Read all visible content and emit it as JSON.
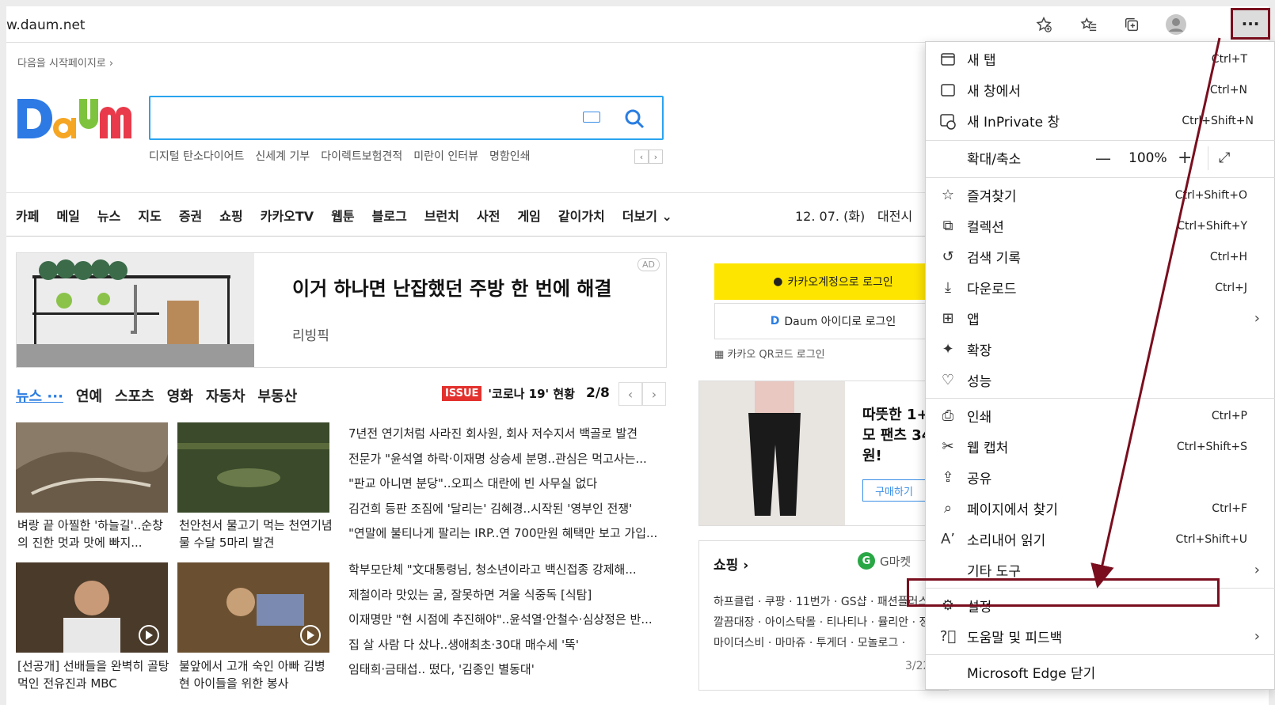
{
  "browser": {
    "url": "w.daum.net"
  },
  "daum": {
    "start_page_link": "다음을 시작페이지로 ›",
    "search": {
      "placeholder": "",
      "suggestions": [
        "디지털 탄소다이어트",
        "신세계 기부",
        "다이렉트보험견적",
        "미란이 인터뷰",
        "명함인쇄"
      ]
    },
    "nav": [
      "카페",
      "메일",
      "뉴스",
      "지도",
      "증권",
      "쇼핑",
      "카카오TV",
      "웹툰",
      "블로그",
      "브런치",
      "사전",
      "게임",
      "같이가치",
      "더보기"
    ],
    "date": "12. 07. (화)",
    "city": "대전시",
    "ad": {
      "title": "이거 하나면 난잡했던 주방 한 번에 해결",
      "source": "리빙픽",
      "badge": "AD"
    },
    "news_tabs": [
      "뉴스",
      "연예",
      "스포츠",
      "영화",
      "자동차",
      "부동산"
    ],
    "issue": {
      "badge": "ISSUE",
      "text": "'코로나 19' 현황",
      "count": "2/8"
    },
    "photo_news": [
      {
        "caption": "벼랑 끝 아찔한 '하늘길'..순창의 진한 멋과 맛에 빠지..."
      },
      {
        "caption": "천안천서 물고기 먹는 천연기념물 수달 5마리 발견"
      },
      {
        "caption": "[선공개] 선배들을 완벽히 골탕 먹인 전유진과 MBC"
      },
      {
        "caption": "불앞에서 고개 숙인 아빠 김병현 아이들을 위한 봉사"
      }
    ],
    "headlines": [
      "7년전 연기처럼 사라진 회사원, 회사 저수지서 백골로 발견",
      "전문가 \"윤석열 하락·이재명 상승세 분명..관심은 먹고사는...",
      "\"판교 아니면 분당\"..오피스 대란에 빈 사무실 없다",
      "김건희 등판 조짐에 '달리는' 김혜경..시작된 '영부인 전쟁'",
      "\"연말에 불티나게 팔리는 IRP..연 700만원 혜택만 보고 가입...",
      "학부모단체 \"文대통령님, 청소년이라고 백신접종 강제해...",
      "제철이라 맛있는 굴, 잘못하면 겨울 식중독 [식탐]",
      "이재명만 \"현 시점에 추진해야\"..윤석열·안철수·심상정은 반...",
      "집 살 사람 다 샀나..생애최초·30대 매수세 '뚝'",
      "임태희·금태섭.. 떴다, '김종인 별동대'"
    ],
    "login": {
      "kakao": "카카오계정으로 로그인",
      "daum": "Daum 아이디로 로그인",
      "qr": "카카오 QR코드 로그인"
    },
    "ad2": {
      "title_lines": [
        "따뜻한 1+1",
        "모 팬츠 34",
        "원!"
      ],
      "button": "구매하기"
    },
    "shopping": {
      "title": "쇼핑 ›",
      "gmarket": "G마켓",
      "lines": [
        "하프클럽 · 쿠팡 · 11번가 · GS샵 · 패션플러스 ·",
        "깔끔대장 · 아이스탁몰 · 티나티나 · 뮬리안 · 정",
        "마이더스비 · 마마쥬 · 투게더 · 모놀로그 ·"
      ],
      "page": "3/22"
    }
  },
  "edge_menu": {
    "items": [
      {
        "label": "새 탭",
        "shortcut": "Ctrl+T",
        "icon": "new-tab-icon"
      },
      {
        "label": "새 창에서",
        "shortcut": "Ctrl+N",
        "icon": "new-window-icon"
      },
      {
        "label": "새 InPrivate 창",
        "shortcut": "Ctrl+Shift+N",
        "icon": "inprivate-icon"
      },
      {
        "label": "확대/축소",
        "zoom": "100%"
      },
      {
        "label": "즐겨찾기",
        "shortcut": "Ctrl+Shift+O",
        "icon": "favorites-icon"
      },
      {
        "label": "컬렉션",
        "shortcut": "Ctrl+Shift+Y",
        "icon": "collections-icon"
      },
      {
        "label": "검색 기록",
        "shortcut": "Ctrl+H",
        "icon": "history-icon"
      },
      {
        "label": "다운로드",
        "shortcut": "Ctrl+J",
        "icon": "download-icon"
      },
      {
        "label": "앱",
        "icon": "apps-icon"
      },
      {
        "label": "확장",
        "icon": "extensions-icon"
      },
      {
        "label": "성능",
        "icon": "performance-icon"
      },
      {
        "label": "인쇄",
        "shortcut": "Ctrl+P",
        "icon": "print-icon"
      },
      {
        "label": "웹 캡처",
        "shortcut": "Ctrl+Shift+S",
        "icon": "web-capture-icon"
      },
      {
        "label": "공유",
        "icon": "share-icon"
      },
      {
        "label": "페이지에서 찾기",
        "shortcut": "Ctrl+F",
        "icon": "find-icon"
      },
      {
        "label": "소리내어 읽기",
        "shortcut": "Ctrl+Shift+U",
        "icon": "read-aloud-icon"
      },
      {
        "label": "기타 도구"
      },
      {
        "label": "설정",
        "icon": "settings-icon"
      },
      {
        "label": "도움말 및 피드백",
        "icon": "help-icon"
      },
      {
        "label": "Microsoft Edge 닫기"
      }
    ]
  },
  "annotation": {
    "highlight_color": "#7a0e1e"
  }
}
